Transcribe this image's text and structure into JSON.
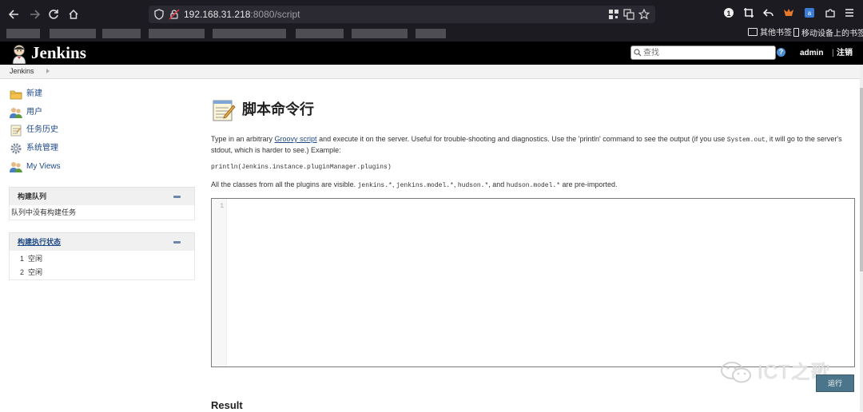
{
  "browser": {
    "url_host": "192.168.31.218",
    "url_path": ":8080/script",
    "bookmarks": [
      "其他书签",
      "移动设备上的书签"
    ]
  },
  "header": {
    "app_name": "Jenkins",
    "search_placeholder": "查找",
    "help_icon": "?",
    "user": "admin",
    "logout": "注销",
    "separator": "|"
  },
  "breadcrumb": [
    "Jenkins"
  ],
  "sidebar": {
    "tasks": [
      {
        "label": "新建",
        "icon": "new-folder-icon"
      },
      {
        "label": "用户",
        "icon": "users-icon"
      },
      {
        "label": "任务历史",
        "icon": "notepad-icon"
      },
      {
        "label": "系统管理",
        "icon": "gear-icon"
      },
      {
        "label": "My Views",
        "icon": "users-icon"
      }
    ],
    "build_queue": {
      "title": "构建队列",
      "empty_text": "队列中没有构建任务"
    },
    "executors": {
      "title": "构建执行状态",
      "items": [
        {
          "num": "1",
          "status": "空闲"
        },
        {
          "num": "2",
          "status": "空闲"
        }
      ]
    }
  },
  "main": {
    "title": "脚本命令行",
    "desc_part1": "Type in an arbitrary ",
    "desc_link": "Groovy script",
    "desc_part2": " and execute it on the server. Useful for trouble-shooting and diagnostics. Use the 'println' command to see the output (if you use ",
    "desc_code": "System.out",
    "desc_part3": ", it will go to the server's stdout, which is harder to see.) Example:",
    "example_code": "println(Jenkins.instance.pluginManager.plugins)",
    "classes_part1": "All the classes from all the plugins are visible. ",
    "classes_code1": "jenkins.*",
    "classes_sep1": ", ",
    "classes_code2": "jenkins.model.*",
    "classes_sep2": ", ",
    "classes_code3": "hudson.*",
    "classes_sep3": ", and ",
    "classes_code4": "hudson.model.*",
    "classes_part2": " are pre-imported.",
    "editor_line_number": "1",
    "editor_content": "",
    "run_button": "运行",
    "result_heading": "Result"
  },
  "watermark": "ICT之歌",
  "colors": {
    "header_bg": "#000000",
    "link": "#204a87",
    "run_button": "#4b758b"
  }
}
